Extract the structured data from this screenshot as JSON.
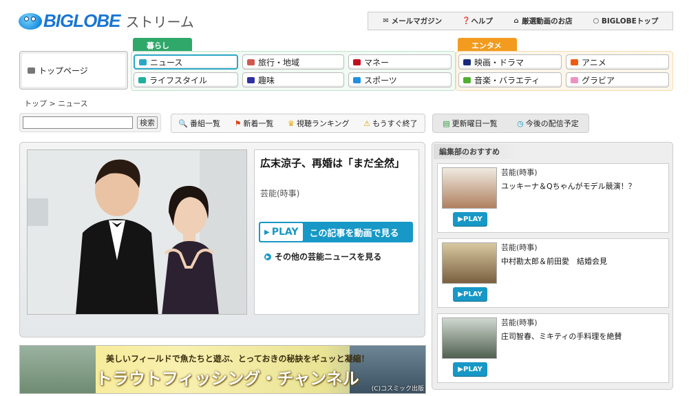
{
  "logo": {
    "brand": "BIGLOBE",
    "sub": "ストリーム"
  },
  "toplinks": [
    {
      "icon": "mail-icon",
      "label": "メールマガジン"
    },
    {
      "icon": "help-icon",
      "label": "ヘルプ"
    },
    {
      "icon": "home-icon",
      "label": "厳選動画のお店"
    },
    {
      "icon": "circle-icon",
      "label": "BIGLOBEトップ"
    }
  ],
  "nav": {
    "toppage": "トップページ",
    "kurashi": {
      "tab": "暮らし",
      "items": [
        "ニュース",
        "旅行・地域",
        "マネー",
        "ライフスタイル",
        "趣味",
        "スポーツ"
      ]
    },
    "entame": {
      "tab": "エンタメ",
      "items": [
        "映画・ドラマ",
        "アニメ",
        "音楽・バラエティ",
        "グラビア"
      ]
    }
  },
  "breadcrumb": {
    "top": "トップ",
    "sep": ">",
    "current": "ニュース"
  },
  "search": {
    "button": "検索",
    "value": ""
  },
  "navbar2": [
    "番組一覧",
    "新着一覧",
    "視聴ランキング",
    "もうすぐ終了"
  ],
  "navbar3": [
    "更新曜日一覧",
    "今後の配信予定"
  ],
  "feature": {
    "title": "広末涼子、再婚は「まだ全然」",
    "category": "芸能(時事)",
    "play_label": "PLAY",
    "play_text": "この記事を動画で見る",
    "more": "その他の芸能ニュースを見る"
  },
  "banner": {
    "line1": "美しいフィールドで魚たちと遊ぶ、とっておきの秘訣をギュッと凝縮！",
    "line2": "トラウトフィッシング・チャンネル",
    "credit": "(C)コスミック出版"
  },
  "sidebar": {
    "heading": "編集部のおすすめ",
    "items": [
      {
        "category": "芸能(時事)",
        "title": "ユッキーナ＆Qちゃんがモデル競演！？",
        "play": "PLAY"
      },
      {
        "category": "芸能(時事)",
        "title": "中村勘太郎＆前田愛　結婚会見",
        "play": "PLAY"
      },
      {
        "category": "芸能(時事)",
        "title": "庄司智春、ミキティの手料理を絶賛",
        "play": "PLAY"
      }
    ]
  },
  "colors": {
    "accent": "#1798c6",
    "kurashi": "#2fa86a",
    "entame": "#f29b1e"
  }
}
